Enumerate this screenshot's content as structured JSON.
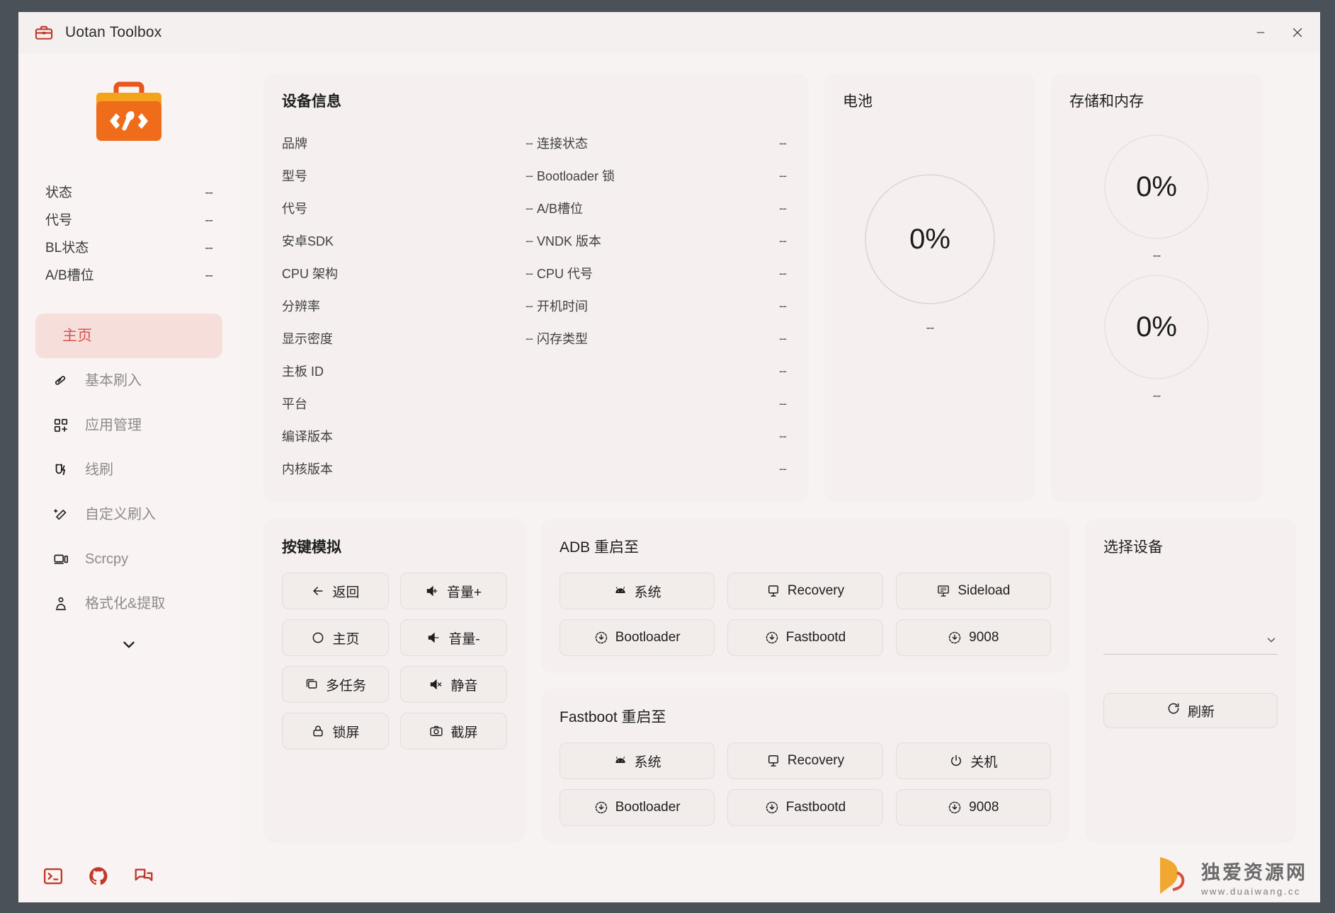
{
  "window": {
    "title": "Uotan Toolbox",
    "app_icon": "toolbox-icon",
    "minimize": "–",
    "close": "✕"
  },
  "sidebar": {
    "logo_icon": "toolbox-logo",
    "stats": [
      {
        "label": "状态",
        "value": "--"
      },
      {
        "label": "代号",
        "value": "--"
      },
      {
        "label": "BL状态",
        "value": "--"
      },
      {
        "label": "A/B槽位",
        "value": "--"
      }
    ],
    "nav": [
      {
        "label": "主页",
        "icon": "home-icon",
        "active": true
      },
      {
        "label": "基本刷入",
        "icon": "flash-icon",
        "active": false
      },
      {
        "label": "应用管理",
        "icon": "apps-icon",
        "active": false
      },
      {
        "label": "线刷",
        "icon": "cable-flash-icon",
        "active": false
      },
      {
        "label": "自定义刷入",
        "icon": "magic-wand-icon",
        "active": false
      },
      {
        "label": "Scrcpy",
        "icon": "screen-mirror-icon",
        "active": false
      },
      {
        "label": "格式化&提取",
        "icon": "extract-icon",
        "active": false
      }
    ],
    "expand_icon": "chevron-down-icon",
    "bottom_icons": [
      {
        "name": "terminal-icon"
      },
      {
        "name": "github-icon"
      },
      {
        "name": "forum-icon"
      }
    ]
  },
  "device_info": {
    "title": "设备信息",
    "rows": [
      {
        "left_label": "品牌",
        "left_value": "--",
        "right_label": "连接状态",
        "right_value": "--"
      },
      {
        "left_label": "型号",
        "left_value": "--",
        "right_label": "Bootloader 锁",
        "right_value": "--"
      },
      {
        "left_label": "代号",
        "left_value": "--",
        "right_label": "A/B槽位",
        "right_value": "--"
      },
      {
        "left_label": "安卓SDK",
        "left_value": "--",
        "right_label": "VNDK 版本",
        "right_value": "--"
      },
      {
        "left_label": "CPU 架构",
        "left_value": "--",
        "right_label": "CPU 代号",
        "right_value": "--"
      },
      {
        "left_label": "分辨率",
        "left_value": "--",
        "right_label": "开机时间",
        "right_value": "--"
      },
      {
        "left_label": "显示密度",
        "left_value": "--",
        "right_label": "闪存类型",
        "right_value": "--"
      },
      {
        "left_label": "主板 ID",
        "left_value": "",
        "right_label": "",
        "right_value": "--"
      },
      {
        "left_label": "平台",
        "left_value": "",
        "right_label": "",
        "right_value": "--"
      },
      {
        "left_label": "编译版本",
        "left_value": "",
        "right_label": "",
        "right_value": "--"
      },
      {
        "left_label": "内核版本",
        "left_value": "",
        "right_label": "",
        "right_value": "--"
      }
    ]
  },
  "battery": {
    "title": "电池",
    "percent_label": "0%",
    "percent_value": 0,
    "sub_label": "--"
  },
  "storage": {
    "title": "存储和内存",
    "gauges": [
      {
        "percent_label": "0%",
        "percent_value": 0,
        "sub_label": "--"
      },
      {
        "percent_label": "0%",
        "percent_value": 0,
        "sub_label": "--"
      }
    ]
  },
  "key_simulation": {
    "title": "按键模拟",
    "buttons": [
      {
        "label": "返回",
        "icon": "arrow-left-icon"
      },
      {
        "label": "音量+",
        "icon": "volume-up-icon"
      },
      {
        "label": "主页",
        "icon": "circle-home-icon"
      },
      {
        "label": "音量-",
        "icon": "volume-down-icon"
      },
      {
        "label": "多任务",
        "icon": "multitask-icon"
      },
      {
        "label": "静音",
        "icon": "volume-mute-icon"
      },
      {
        "label": "锁屏",
        "icon": "lock-icon"
      },
      {
        "label": "截屏",
        "icon": "camera-icon"
      }
    ]
  },
  "adb_reboot": {
    "title": "ADB 重启至",
    "buttons": [
      {
        "label": "系统",
        "icon": "android-icon"
      },
      {
        "label": "Recovery",
        "icon": "monitor-icon"
      },
      {
        "label": "Sideload",
        "icon": "sideload-icon"
      },
      {
        "label": "Bootloader",
        "icon": "download-circle-icon"
      },
      {
        "label": "Fastbootd",
        "icon": "download-circle-icon"
      },
      {
        "label": "9008",
        "icon": "download-circle-icon"
      }
    ]
  },
  "fastboot_reboot": {
    "title": "Fastboot 重启至",
    "buttons": [
      {
        "label": "系统",
        "icon": "android-icon"
      },
      {
        "label": "Recovery",
        "icon": "monitor-icon"
      },
      {
        "label": "关机",
        "icon": "power-icon"
      },
      {
        "label": "Bootloader",
        "icon": "download-circle-icon"
      },
      {
        "label": "Fastbootd",
        "icon": "download-circle-icon"
      },
      {
        "label": "9008",
        "icon": "download-circle-icon"
      }
    ]
  },
  "device_select": {
    "title": "选择设备",
    "selected_value": "",
    "dropdown_icon": "chevron-down-icon",
    "refresh_label": "刷新",
    "refresh_icon": "refresh-icon"
  },
  "watermark": {
    "main": "独爱资源网",
    "sub": "www.duaiwang.cc"
  },
  "colors": {
    "accent": "#d9534f",
    "accent_bg": "#f6dedb",
    "app_bg": "#f7f3f2",
    "card_bg": "#f5f0ef",
    "sidebar_bg": "#f9f4f3"
  }
}
